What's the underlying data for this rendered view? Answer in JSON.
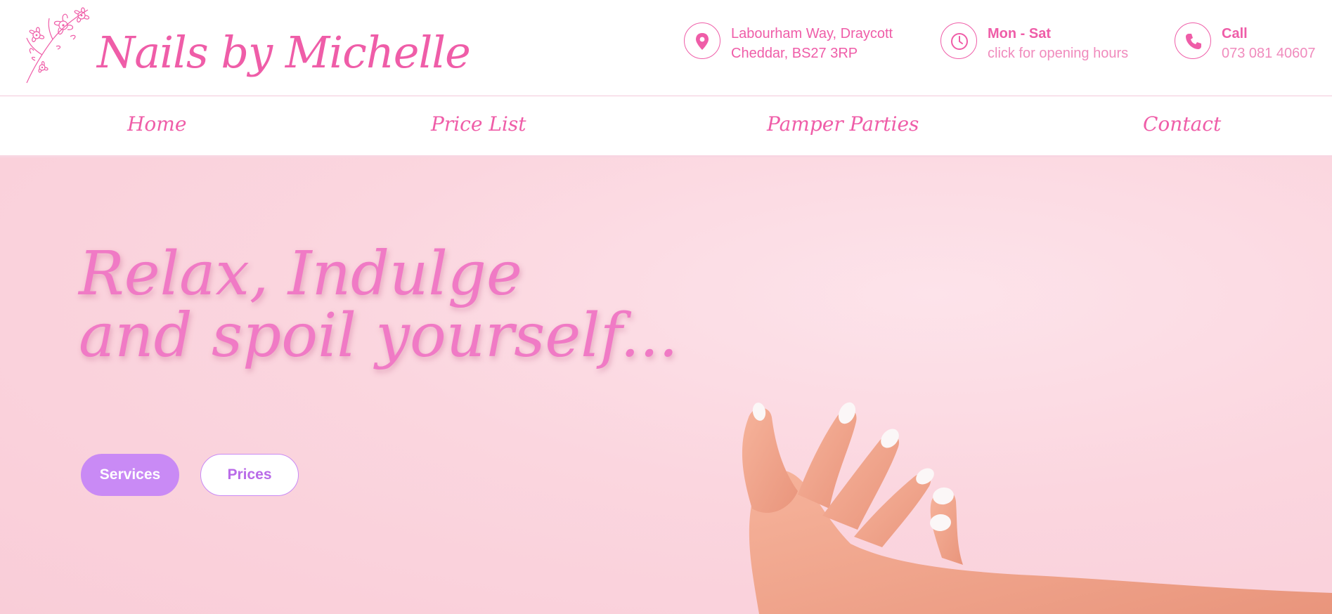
{
  "brand": {
    "name": "Nails by Michelle",
    "accent_color": "#ef5da8",
    "button_color": "#c98af5",
    "logo_icon": "flower-icon"
  },
  "contact": {
    "location": {
      "icon": "map-pin-icon",
      "line1": "Labourham Way, Draycott",
      "line2": "Cheddar, BS27 3RP"
    },
    "hours": {
      "icon": "clock-icon",
      "line1": "Mon - Sat",
      "line2": "click for opening hours"
    },
    "phone": {
      "icon": "phone-icon",
      "line1": "Call",
      "line2": "073 081 40607"
    }
  },
  "nav": {
    "items": [
      {
        "label": "Home"
      },
      {
        "label": "Price List"
      },
      {
        "label": "Pamper Parties"
      },
      {
        "label": "Contact"
      }
    ]
  },
  "hero": {
    "line1": "Relax, Indulge",
    "line2": "and spoil yourself...",
    "buttons": {
      "services": "Services",
      "prices": "Prices"
    }
  }
}
